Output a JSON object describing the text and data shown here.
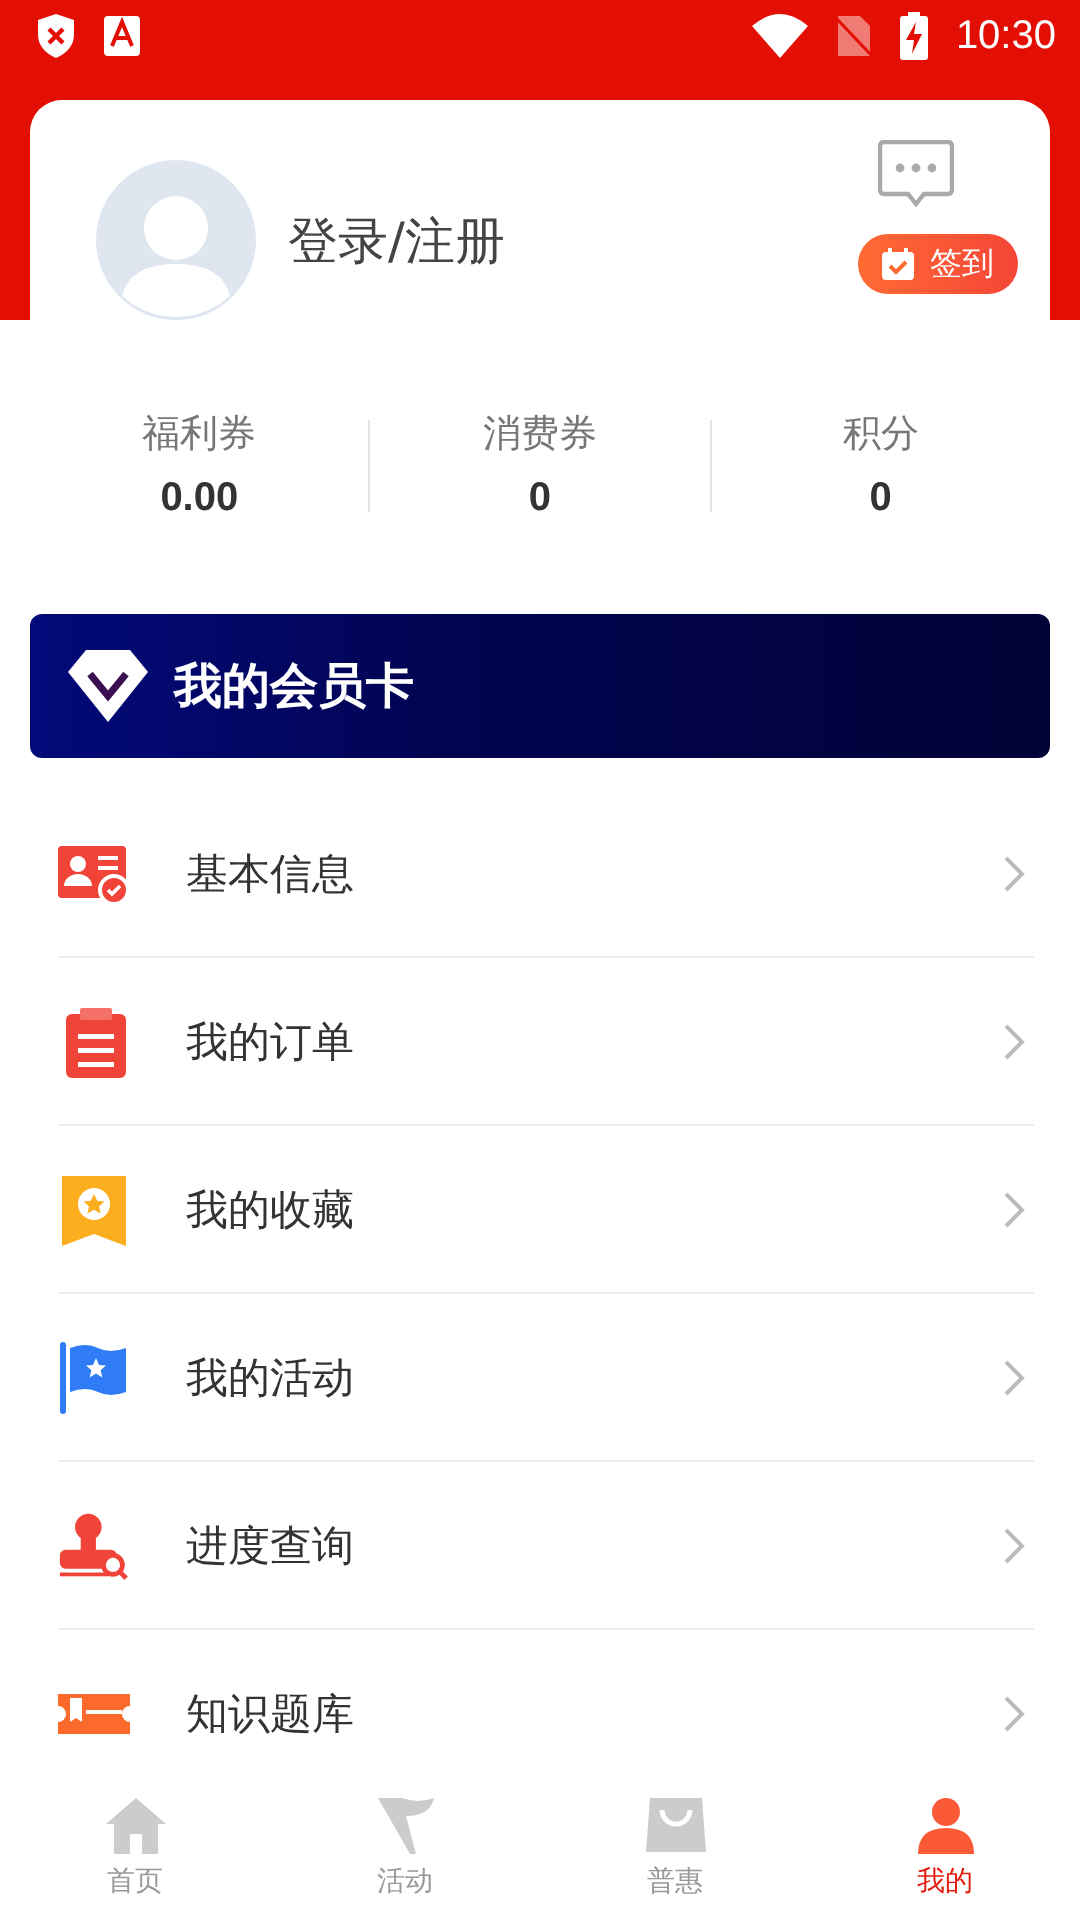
{
  "status_bar": {
    "time": "10:30"
  },
  "profile": {
    "login_label": "登录/注册",
    "checkin_label": "签到"
  },
  "stats": [
    {
      "label": "福利券",
      "value": "0.00"
    },
    {
      "label": "消费券",
      "value": "0"
    },
    {
      "label": "积分",
      "value": "0"
    }
  ],
  "member_card": {
    "title": "我的会员卡"
  },
  "menu": [
    {
      "kind": "info",
      "label": "基本信息"
    },
    {
      "kind": "order",
      "label": "我的订单"
    },
    {
      "kind": "favorite",
      "label": "我的收藏"
    },
    {
      "kind": "activity",
      "label": "我的活动"
    },
    {
      "kind": "progress",
      "label": "进度查询"
    },
    {
      "kind": "quiz",
      "label": "知识题库"
    }
  ],
  "tabs": [
    {
      "kind": "home",
      "label": "首页",
      "selected": false
    },
    {
      "kind": "activity",
      "label": "活动",
      "selected": false
    },
    {
      "kind": "deals",
      "label": "普惠",
      "selected": false
    },
    {
      "kind": "mine",
      "label": "我的",
      "selected": true
    }
  ]
}
